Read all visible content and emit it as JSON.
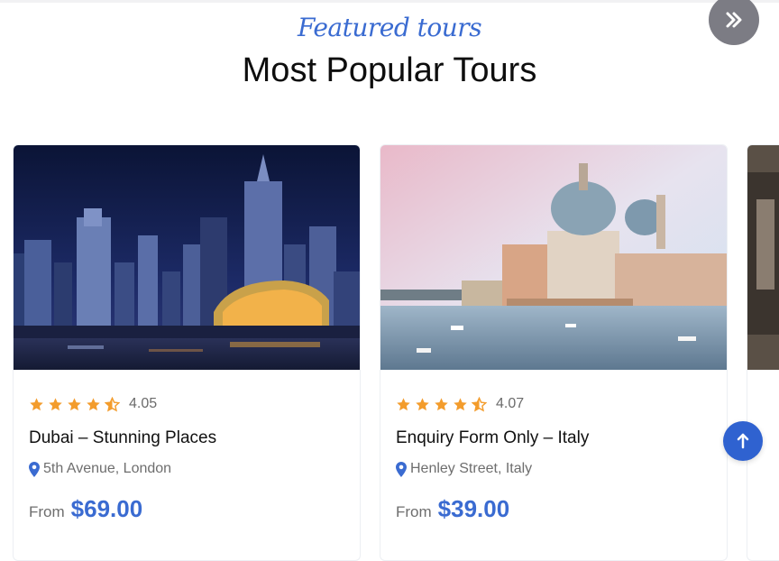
{
  "section": {
    "kicker": "Featured tours",
    "title": "Most Popular Tours"
  },
  "nav": {
    "next_icon": "double-chevron-right-icon"
  },
  "tours": [
    {
      "name": "Dubai – Stunning Places",
      "rating": "4.05",
      "rating_value": 4.05,
      "location": "5th Avenue, London",
      "price_prefix": "From",
      "price": "$69.00"
    },
    {
      "name": "Enquiry Form Only – Italy",
      "rating": "4.07",
      "rating_value": 4.07,
      "location": "Henley Street, Italy",
      "price_prefix": "From",
      "price": "$39.00"
    }
  ],
  "scroll_top_icon": "arrow-up-icon",
  "colors": {
    "accent": "#3a6bd1",
    "star": "#f39c2c",
    "text": "#111111",
    "muted": "#6e6e6e"
  }
}
